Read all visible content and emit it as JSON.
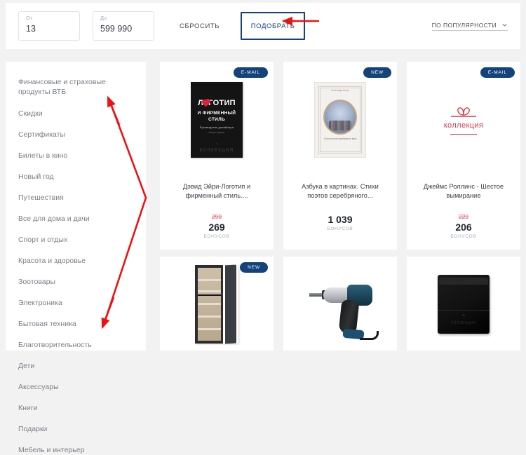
{
  "filter_bar": {
    "from": {
      "label": "От",
      "value": "13"
    },
    "to": {
      "label": "До",
      "value": "599 990"
    },
    "reset_label": "СБРОСИТЬ",
    "apply_label": "ПОДОБРАТЬ",
    "sort_label": "ПО ПОПУЛЯРНОСТИ",
    "sort_icon": "chevron-down-icon"
  },
  "sidebar": {
    "items": [
      {
        "label": "Финансовые и страховые продукты ВТБ"
      },
      {
        "label": "Скидки"
      },
      {
        "label": "Сертификаты"
      },
      {
        "label": "Билеты в кино"
      },
      {
        "label": "Новый год"
      },
      {
        "label": "Путешествия"
      },
      {
        "label": "Все для дома и дачи"
      },
      {
        "label": "Спорт и отдых"
      },
      {
        "label": "Красота и здоровье"
      },
      {
        "label": "Зоотовары"
      },
      {
        "label": "Электроника"
      },
      {
        "label": "Бытовая техника"
      },
      {
        "label": "Благотворительность"
      },
      {
        "label": "Дети"
      },
      {
        "label": "Аксессуары"
      },
      {
        "label": "Книги"
      },
      {
        "label": "Подарки"
      },
      {
        "label": "Мебель и интерьер"
      }
    ]
  },
  "products": {
    "bonus_label": "БОНУСОВ",
    "row1": [
      {
        "badge": "E-MAIL",
        "title": "Дэвид Эйри-Логотип и фирменный стиль....",
        "old_price": "299",
        "price": "269",
        "image": "book-logotip-cover",
        "cover": {
          "line1_a": "Л",
          "line1_b": "ГОТИП",
          "line2": "И ФИРМЕННЫЙ СТИЛЬ",
          "line3": "Руководство дизайнера",
          "line4": "Второе издание",
          "mark": "✧",
          "brand": "КОЛЛЕКЦИЯ"
        }
      },
      {
        "badge": "NEW",
        "title": "Азбука в картинах. Стихи поэтов серебряного...",
        "old_price": "",
        "price": "1 039",
        "image": "book-azbuka-cover",
        "cover": {
          "top": "Александр Бенуа",
          "title": "Азбука в картинах",
          "sub": "Стихи поэтов серебряного века"
        }
      },
      {
        "badge": "E-MAIL",
        "title": "Джеймс Роллинс - Шестое вымирание",
        "old_price": "229",
        "price": "206",
        "image": "kollekciya-logo",
        "logo": {
          "word": "коллекция",
          "icon": "bow-ribbon-icon"
        }
      }
    ],
    "row2": [
      {
        "badge": "NEW",
        "image": "refrigerator-photo"
      },
      {
        "badge": "",
        "image": "impact-driver-photo"
      },
      {
        "badge": "",
        "image": "leather-wallet-photo",
        "mark": "КОЛЛЕКЦИЯ"
      }
    ]
  },
  "annotations": {
    "arrow_to_apply": "arrow-pointing-left-to-apply-button",
    "arrow_sidebar_range": "double-headed-arrow-over-categories",
    "color": "#ee1111"
  },
  "colors": {
    "accent": "#14427a",
    "annotation": "#ee1111",
    "page_bg": "#f2f2f2",
    "old_price": "#e05a6b"
  }
}
